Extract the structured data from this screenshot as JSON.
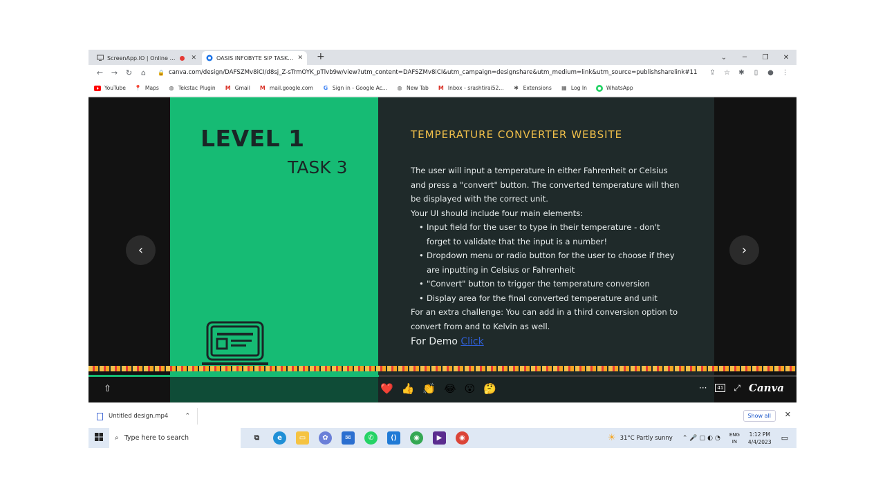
{
  "browser": {
    "tabs": [
      {
        "title": "ScreenApp.IO | Online Scree",
        "recording": true
      },
      {
        "title": "OASIS INFOBYTE SIP TASK LIST",
        "active": true
      }
    ],
    "url": "canva.com/design/DAFSZMv8iCI/d8sj_Z-sTrmOYK_pTlvb9w/view?utm_content=DAFSZMv8iCI&utm_campaign=designshare&utm_medium=link&utm_source=publishsharelink#11",
    "bookmarks": [
      {
        "label": "YouTube",
        "icon": "youtube-icon",
        "color": "#ff0000"
      },
      {
        "label": "Maps",
        "icon": "maps-icon",
        "color": "#34a853"
      },
      {
        "label": "Tekstac Plugin",
        "icon": "globe-icon",
        "color": "#555555"
      },
      {
        "label": "Gmail",
        "icon": "gmail-icon",
        "color": "#d93025"
      },
      {
        "label": "mail.google.com",
        "icon": "gmail-icon",
        "color": "#d93025"
      },
      {
        "label": "Sign in - Google Ac...",
        "icon": "google-icon",
        "color": "#4285f4"
      },
      {
        "label": "New Tab",
        "icon": "globe-icon",
        "color": "#555555"
      },
      {
        "label": "Inbox - srashtirai52...",
        "icon": "gmail-icon",
        "color": "#d93025"
      },
      {
        "label": "Extensions",
        "icon": "puzzle-icon",
        "color": "#555555"
      },
      {
        "label": "Log In",
        "icon": "grid-icon",
        "color": "#555555"
      },
      {
        "label": "WhatsApp",
        "icon": "whatsapp-icon",
        "color": "#25d366"
      }
    ]
  },
  "slide": {
    "level": "LEVEL 1",
    "task": "TASK 3",
    "heading": "TEMPERATURE CONVERTER WEBSITE",
    "intro": "The user will input a temperature in either Fahrenheit or Celsius and press a \"convert\" button. The converted temperature will then be displayed with the correct unit.",
    "ui_intro": "Your UI should include four main elements:",
    "bullets": [
      "Input field for the user to type in their temperature - don't forget to validate that the input is a number!",
      "Dropdown menu or radio button for the user to choose if they are inputting in Celsius or Fahrenheit",
      "\"Convert\" button to trigger the temperature conversion",
      "Display area for the final converted temperature and unit"
    ],
    "extra": "For an extra challenge: You can add in a third conversion option to convert from and to Kelvin as well.",
    "demo_label": "For Demo",
    "demo_link": "Click",
    "accent": "#16bb74",
    "heading_color": "#f2c04a"
  },
  "viewer": {
    "reactions": [
      "❤️",
      "👍",
      "👏",
      "😂",
      "😮",
      "🤔"
    ],
    "page_counter": "41",
    "brand": "Canva"
  },
  "downloads": {
    "file": "Untitled design.mp4",
    "show_all": "Show all"
  },
  "taskbar": {
    "search_placeholder": "Type here to search",
    "weather": "31°C  Partly sunny",
    "lang1": "ENG",
    "lang2": "IN",
    "time": "1:12 PM",
    "date": "4/4/2023"
  }
}
